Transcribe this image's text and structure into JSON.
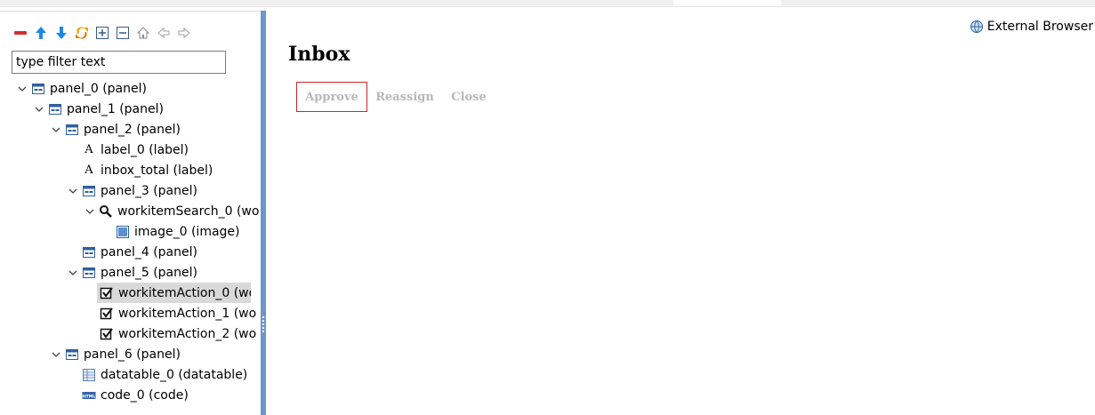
{
  "toolbar": {
    "buttons": [
      {
        "name": "remove-icon",
        "color": "#d32f2f"
      },
      {
        "name": "move-up-icon",
        "color": "#1e88e5"
      },
      {
        "name": "move-down-icon",
        "color": "#1e88e5"
      },
      {
        "name": "refresh-icon",
        "color": "#f0a000"
      },
      {
        "name": "expand-all-icon"
      },
      {
        "name": "collapse-all-icon"
      },
      {
        "name": "home-icon"
      },
      {
        "name": "back-icon"
      },
      {
        "name": "forward-icon"
      }
    ]
  },
  "filter": {
    "placeholder": "type filter text",
    "value": ""
  },
  "tree": {
    "nodes": [
      {
        "label": "panel_0 (panel)",
        "icon": "panel-icon",
        "expanded": true
      },
      {
        "label": "panel_1 (panel)",
        "icon": "panel-icon",
        "expanded": true
      },
      {
        "label": "panel_2 (panel)",
        "icon": "panel-icon",
        "expanded": true
      },
      {
        "label": "label_0 (label)",
        "icon": "label-icon",
        "glyph": "A"
      },
      {
        "label": "inbox_total (label)",
        "icon": "label-icon",
        "glyph": "A"
      },
      {
        "label": "panel_3 (panel)",
        "icon": "panel-icon",
        "expanded": true
      },
      {
        "label": "workitemSearch_0 (wo",
        "icon": "search-icon",
        "expanded": true
      },
      {
        "label": "image_0 (image)",
        "icon": "image-icon"
      },
      {
        "label": "panel_4 (panel)",
        "icon": "panel-icon"
      },
      {
        "label": "panel_5 (panel)",
        "icon": "panel-icon",
        "expanded": true
      },
      {
        "label": "workitemAction_0 (wo",
        "icon": "checkbox-icon",
        "selected": true
      },
      {
        "label": "workitemAction_1 (wo",
        "icon": "checkbox-icon"
      },
      {
        "label": "workitemAction_2 (wo",
        "icon": "checkbox-icon"
      },
      {
        "label": "panel_6 (panel)",
        "icon": "panel-icon",
        "expanded": true
      },
      {
        "label": "datatable_0 (datatable)",
        "icon": "datatable-icon"
      },
      {
        "label": "code_0 (code)",
        "icon": "code-icon",
        "glyph": "HTML"
      }
    ]
  },
  "content": {
    "external_browser_label": "External Browser",
    "title": "Inbox",
    "actions": {
      "approve": "Approve",
      "reassign": "Reassign",
      "close": "Close"
    }
  },
  "colors": {
    "splitter": "#6f96cc",
    "approve_border": "#c62828",
    "disabled_text": "#b8b8b8",
    "selection": "#d9d9d9"
  }
}
